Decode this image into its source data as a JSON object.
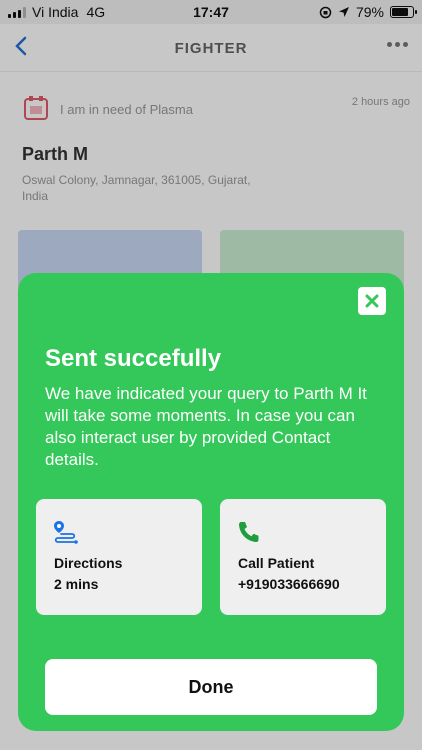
{
  "status_bar": {
    "carrier": "Vi India",
    "network": "4G",
    "time": "17:47",
    "battery": "79%",
    "battery_level": 0.79
  },
  "header": {
    "title": "FIGHTER",
    "back_icon": "chevron-left-icon",
    "more_icon": "more-horizontal-icon"
  },
  "request": {
    "text": "I am in need of Plasma",
    "time": "2 hours ago",
    "name": "Parth M",
    "address": "Oswal Colony, Jamnagar, 361005, Gujarat, India"
  },
  "modal": {
    "title": "Sent succefully",
    "message": "We have indicated your query to Parth M It will take some moments. In case you can also interact user by provided Contact details.",
    "close_icon": "close-icon",
    "directions": {
      "label": "Directions",
      "value": "2 mins",
      "icon": "directions-icon"
    },
    "call": {
      "label": "Call Patient",
      "value": "+919033666690",
      "icon": "phone-icon"
    },
    "done_label": "Done"
  },
  "colors": {
    "modal_green": "#34c759",
    "icon_blue": "#1a73e8",
    "icon_green": "#1e9e3e"
  }
}
